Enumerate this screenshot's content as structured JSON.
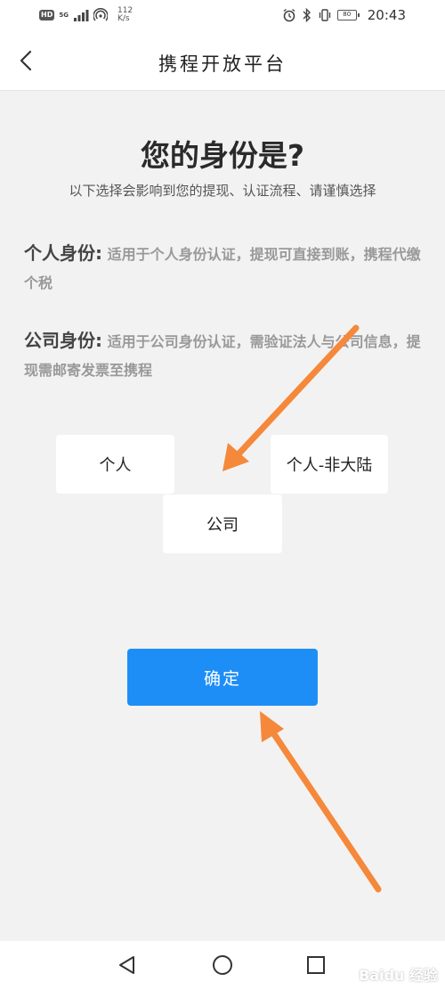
{
  "status_bar": {
    "hd": "HD",
    "network": "5G",
    "speed_value": "112",
    "speed_unit": "K/s",
    "battery": "80",
    "time": "20:43"
  },
  "header": {
    "title": "携程开放平台"
  },
  "page": {
    "title": "您的身份是?",
    "subtitle": "以下选择会影响到您的提现、认证流程、请谨慎选择"
  },
  "identities": {
    "personal": {
      "term": "个人身份:",
      "description": "适用于个人身份认证，提现可直接到账，携程代缴个税"
    },
    "company": {
      "term": "公司身份:",
      "description": "适用于公司身份认证，需验证法人与公司信息，提现需邮寄发票至携程"
    }
  },
  "options": {
    "personal": "个人",
    "non_mainland": "个人-非大陆",
    "company": "公司"
  },
  "confirm_label": "确定",
  "watermark": "Baidu 经验",
  "colors": {
    "accent": "#1e8ef7",
    "arrow": "#f5883a",
    "background": "#f2f2f2"
  }
}
